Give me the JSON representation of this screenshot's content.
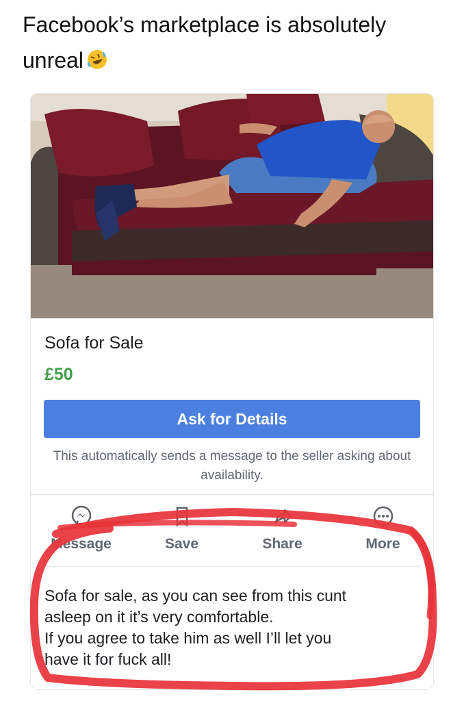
{
  "caption": {
    "text": "Facebook’s marketplace is absolutely unreal",
    "emoji": "rolling-on-the-floor-laughing-emoji"
  },
  "listing": {
    "photo": "man-asleep-on-red-sofa",
    "title": "Sofa for Sale",
    "price": "£50",
    "ask_button": "Ask for Details",
    "note": "This automatically sends a message to the seller asking about availability.",
    "price_color": "#42a04a",
    "button_color": "#4b7fe0"
  },
  "actions": [
    {
      "label": "Message",
      "icon": "messenger-icon"
    },
    {
      "label": "Save",
      "icon": "bookmark-icon"
    },
    {
      "label": "Share",
      "icon": "share-icon"
    },
    {
      "label": "More",
      "icon": "more-icon"
    }
  ],
  "description": {
    "lines": [
      "Sofa for sale, as you can see from this cunt",
      "asleep on it it’s very comfortable.",
      "If you agree to take him as well I’ll let you",
      "have it for fuck all!"
    ]
  },
  "annotation": {
    "type": "red-marker-circle",
    "color": "#e8323a"
  }
}
